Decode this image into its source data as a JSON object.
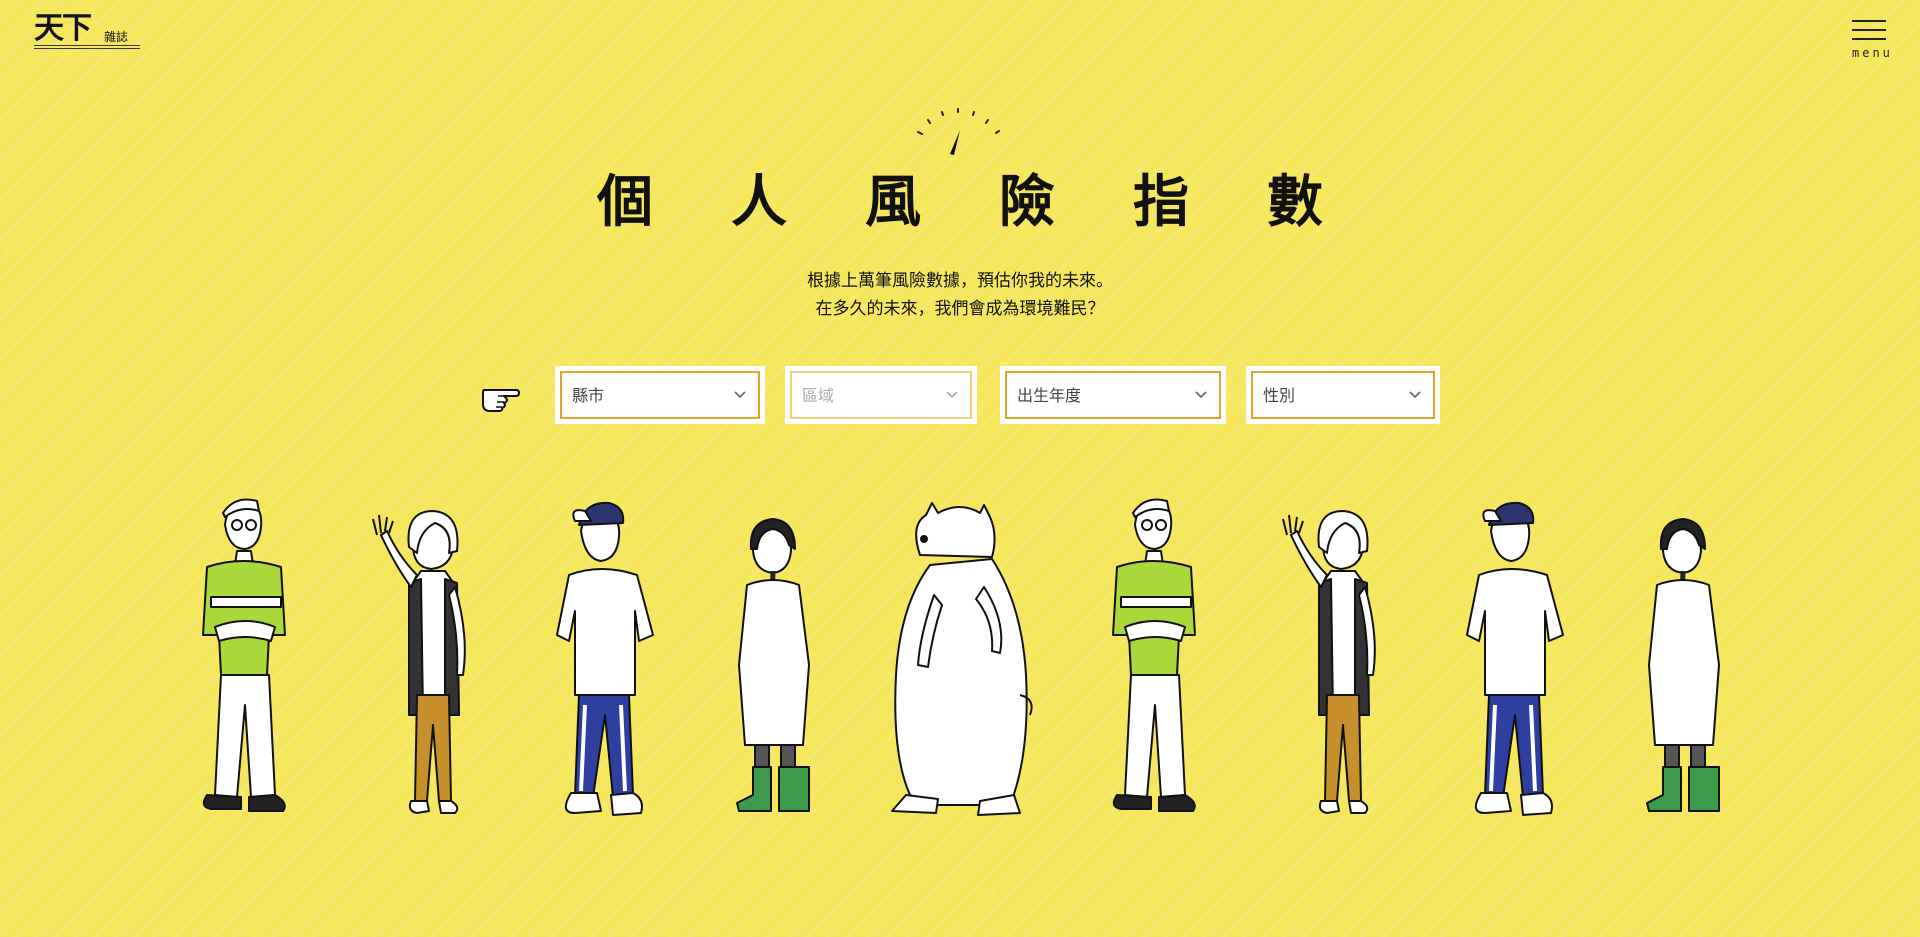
{
  "header": {
    "logo_main": "天下",
    "logo_sub": "雜誌",
    "menu_label": "menu"
  },
  "hero": {
    "title": "個人風險指數",
    "subtitle_lines": [
      "根據上萬筆風險數據，預估你我的未來。",
      "在多久的未來，我們會成為環境難民？"
    ]
  },
  "filters": [
    {
      "label": "縣市",
      "state": "enabled"
    },
    {
      "label": "區域",
      "state": "disabled"
    },
    {
      "label": "出生年度",
      "state": "enabled"
    },
    {
      "label": "性別",
      "state": "enabled"
    }
  ],
  "characters": [
    {
      "name": "man-glasses-green-shirt-icon"
    },
    {
      "name": "woman-waving-icon"
    },
    {
      "name": "cap-guy-blue-pants-icon"
    },
    {
      "name": "girl-braids-green-boots-icon"
    },
    {
      "name": "polar-bear-icon"
    },
    {
      "name": "man-glasses-green-shirt-icon"
    },
    {
      "name": "woman-waving-icon"
    },
    {
      "name": "cap-guy-blue-pants-icon"
    },
    {
      "name": "girl-braids-green-boots-icon"
    }
  ],
  "colors": {
    "background": "#f5e65c",
    "select_border": "#e5a526",
    "select_border_disabled": "#f0cf7b",
    "shirt_green": "#a8d83a",
    "pants_orange": "#c8902a",
    "pants_blue": "#2f3fa0",
    "boots_green": "#3d9a4a"
  }
}
